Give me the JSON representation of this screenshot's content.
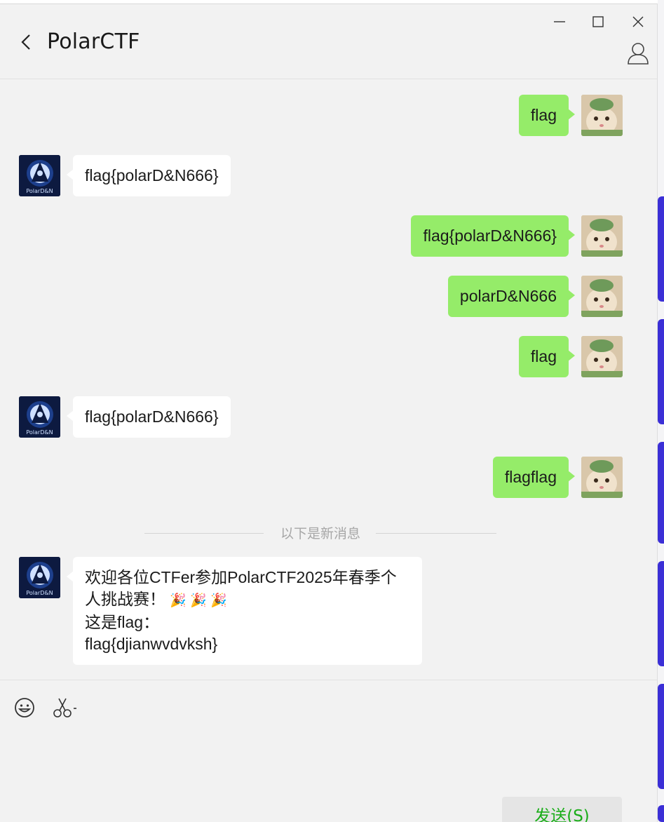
{
  "window": {
    "title": "PolarCTF",
    "controls": {
      "minimize": "—",
      "maximize": "☐",
      "close": "✕"
    }
  },
  "colors": {
    "my_bubble": "#95ec69",
    "their_bubble": "#ffffff",
    "send_text": "#1aad19",
    "background": "#f2f2f2"
  },
  "messages": [
    {
      "sender": "me",
      "text": "flag"
    },
    {
      "sender": "them",
      "text": "flag{polarD&N666}"
    },
    {
      "sender": "me",
      "text": "flag{polarD&N666}"
    },
    {
      "sender": "me",
      "text": "polarD&N666"
    },
    {
      "sender": "me",
      "text": "flag"
    },
    {
      "sender": "them",
      "text": "flag{polarD&N666}"
    },
    {
      "sender": "me",
      "text": "flagflag"
    }
  ],
  "new_message_divider": "以下是新消息",
  "last_message": {
    "sender": "them",
    "line1": "欢迎各位CTFer参加PolarCTF2025年春季个",
    "line2": "人挑战赛！",
    "line2_emojis": "🎉 🎉 🎉",
    "line3": "这是flag：",
    "line4": "flag{djianwvdvksh}"
  },
  "avatar_them_label": "PolarD&N",
  "composer": {
    "emoji_icon": "smiley-icon",
    "scissors_icon": "scissors-icon",
    "send_label": "发送(S)"
  }
}
